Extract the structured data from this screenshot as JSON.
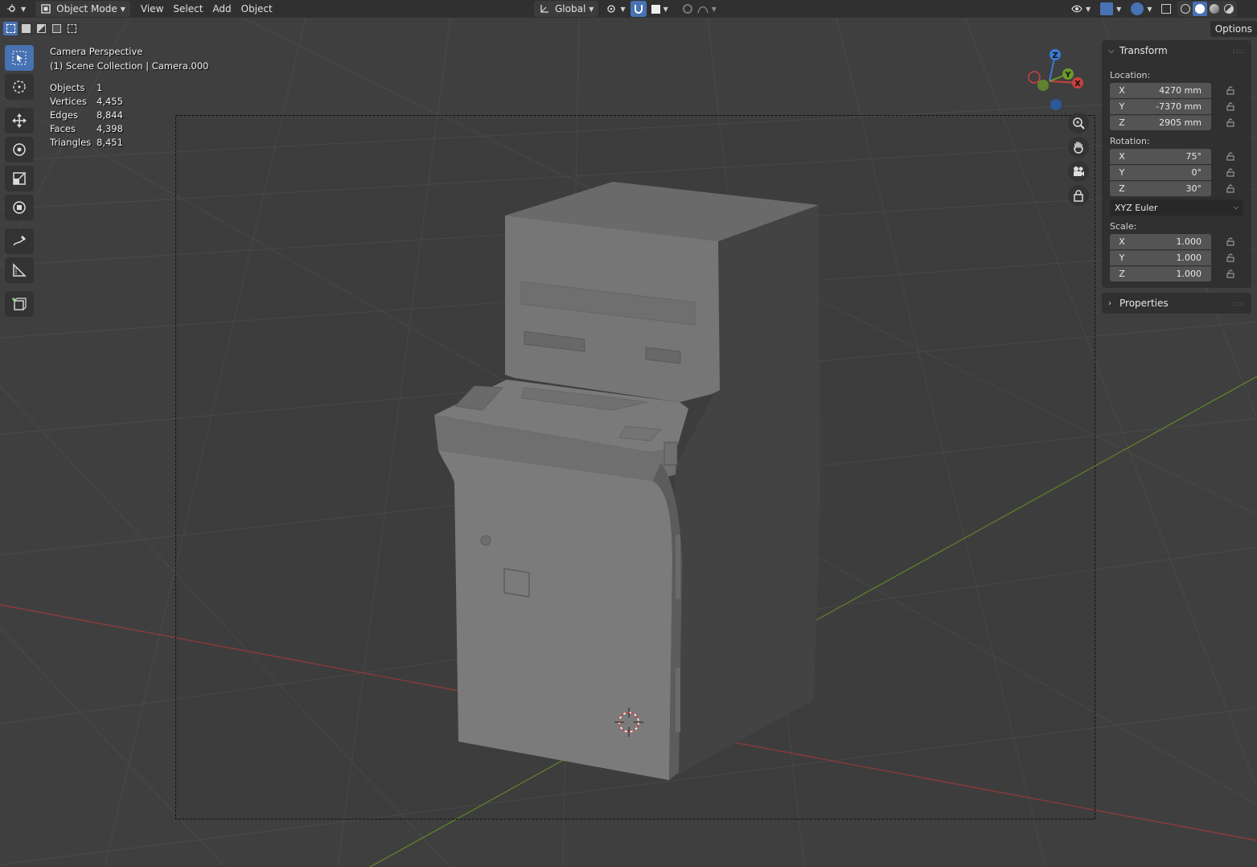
{
  "header": {
    "mode_label": "Object Mode",
    "menus": [
      "View",
      "Select",
      "Add",
      "Object"
    ],
    "orientation_label": "Global",
    "options_label": "Options"
  },
  "overlay": {
    "view_name": "Camera Perspective",
    "collection_path": "(1) Scene Collection | Camera.000",
    "stats": [
      {
        "label": "Objects",
        "value": "1"
      },
      {
        "label": "Vertices",
        "value": "4,455"
      },
      {
        "label": "Edges",
        "value": "8,844"
      },
      {
        "label": "Faces",
        "value": "4,398"
      },
      {
        "label": "Triangles",
        "value": "8,451"
      }
    ]
  },
  "gizmo": {
    "x": "X",
    "y": "Y",
    "z": "Z"
  },
  "transform_panel": {
    "title": "Transform",
    "location_label": "Location:",
    "location": [
      {
        "axis": "X",
        "value": "4270 mm"
      },
      {
        "axis": "Y",
        "value": "-7370 mm"
      },
      {
        "axis": "Z",
        "value": "2905 mm"
      }
    ],
    "rotation_label": "Rotation:",
    "rotation": [
      {
        "axis": "X",
        "value": "75°"
      },
      {
        "axis": "Y",
        "value": "0°"
      },
      {
        "axis": "Z",
        "value": "30°"
      }
    ],
    "rotation_mode": "XYZ Euler",
    "scale_label": "Scale:",
    "scale": [
      {
        "axis": "X",
        "value": "1.000"
      },
      {
        "axis": "Y",
        "value": "1.000"
      },
      {
        "axis": "Z",
        "value": "1.000"
      }
    ]
  },
  "properties_panel": {
    "title": "Properties"
  },
  "colors": {
    "axis_x": "#c8423f",
    "axis_y": "#6b9a2b",
    "axis_z": "#3b7bd4",
    "accent": "#4772b3"
  }
}
